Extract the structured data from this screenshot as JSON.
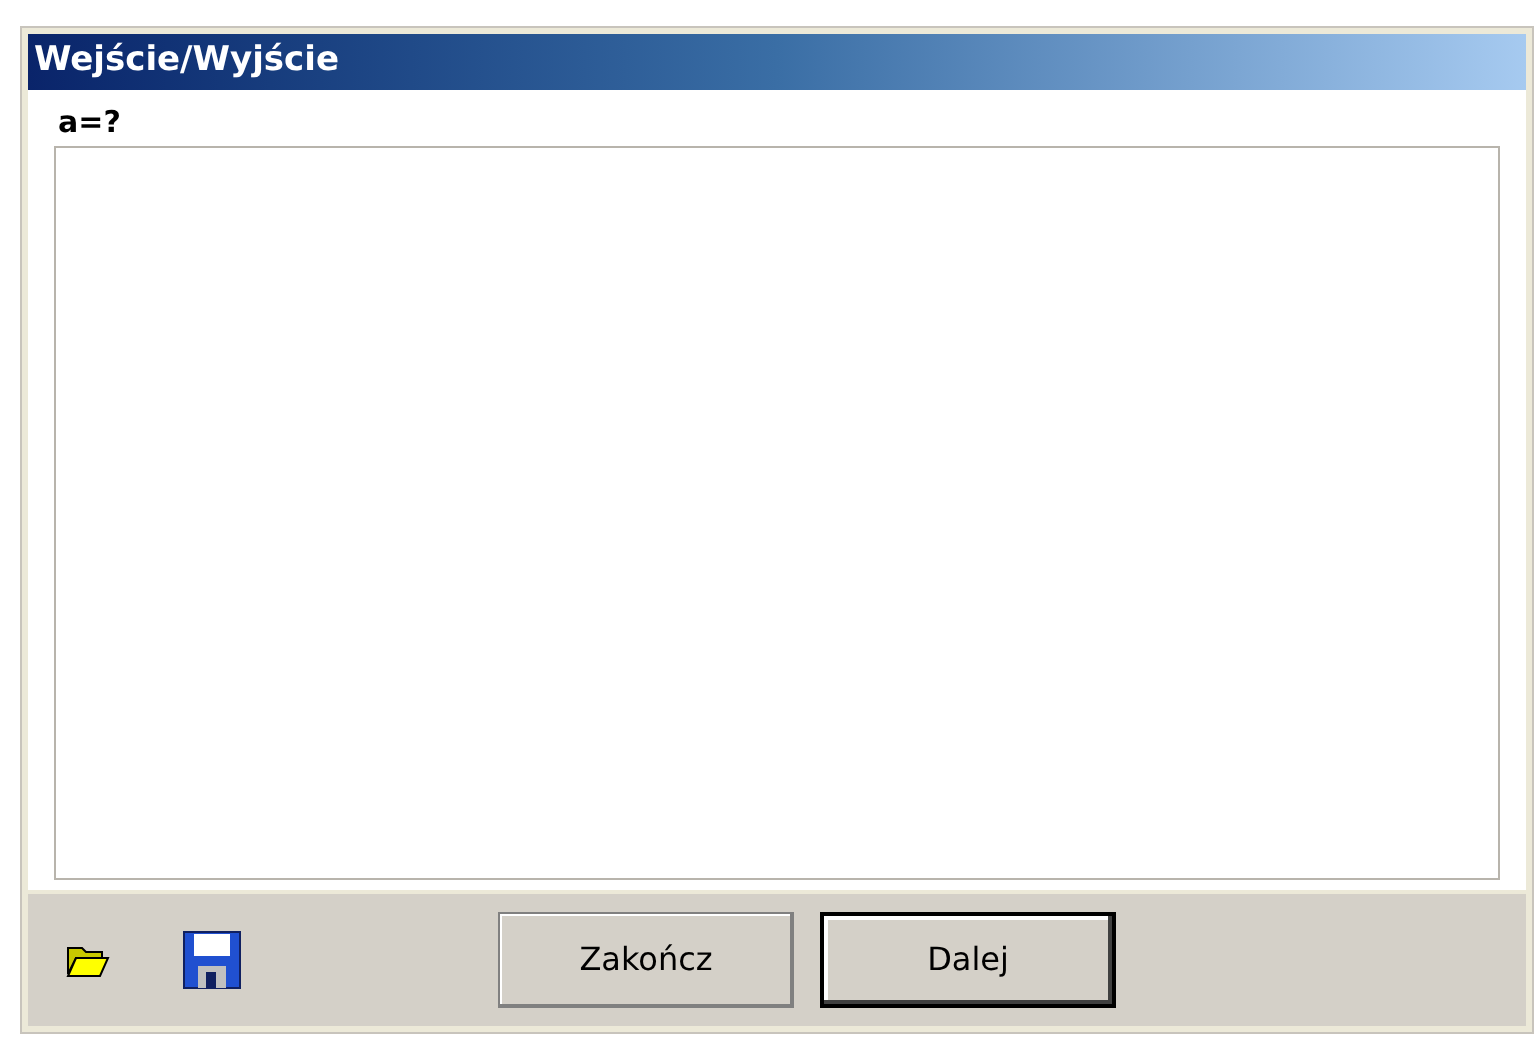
{
  "window": {
    "title": "Wejście/Wyjście"
  },
  "prompt": "a=?",
  "buttons": [
    {
      "label": "Zakończ",
      "default": false
    },
    {
      "label": "Dalej",
      "default": true
    }
  ]
}
